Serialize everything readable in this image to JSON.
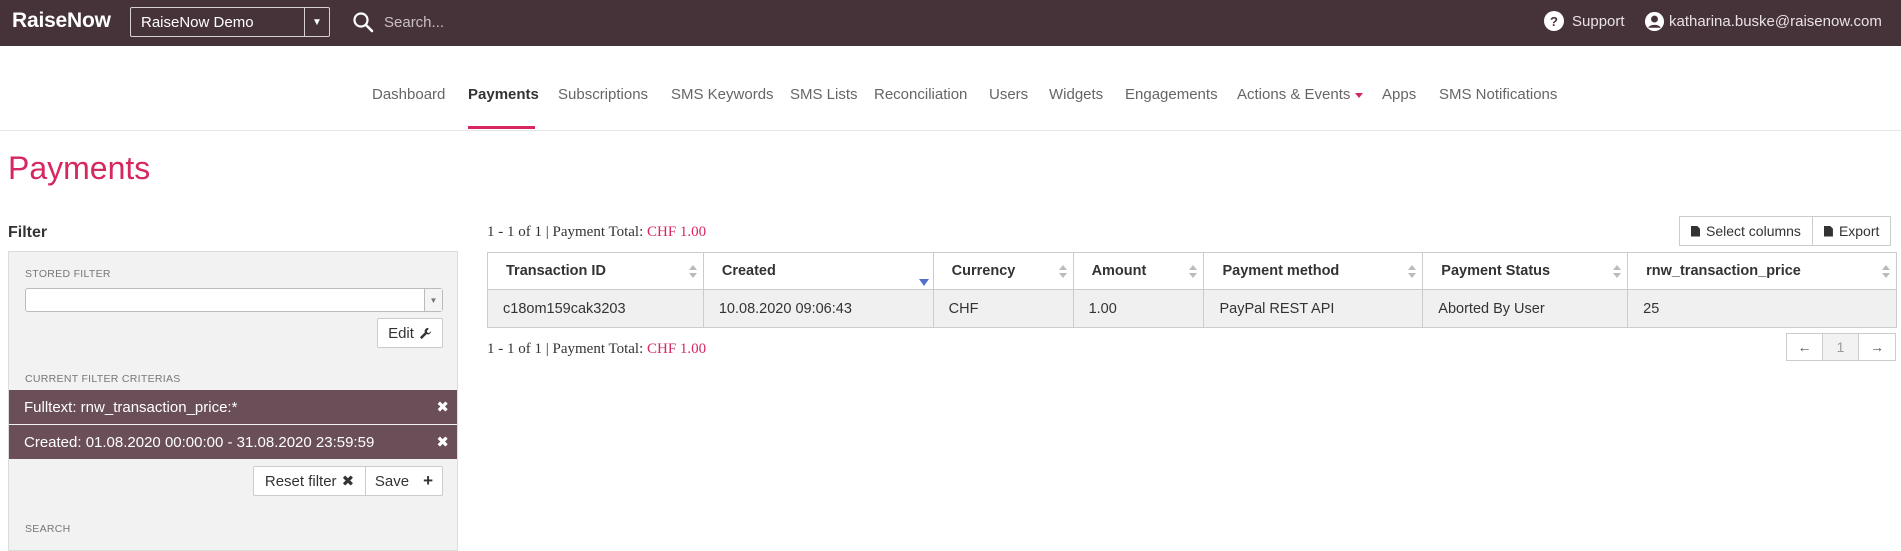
{
  "app": {
    "logo": "RaiseNow",
    "org_selector": "RaiseNow Demo",
    "search_placeholder": "Search...",
    "support_label": "Support",
    "user_email": "katharina.buske@raisenow.com"
  },
  "nav": {
    "items": [
      {
        "label": "Dashboard"
      },
      {
        "label": "Payments",
        "active": true
      },
      {
        "label": "Subscriptions"
      },
      {
        "label": "SMS Keywords"
      },
      {
        "label": "SMS Lists"
      },
      {
        "label": "Reconciliation"
      },
      {
        "label": "Users"
      },
      {
        "label": "Widgets"
      },
      {
        "label": "Engagements"
      },
      {
        "label": "Actions & Events",
        "has_dropdown": true
      },
      {
        "label": "Apps"
      },
      {
        "label": "SMS Notifications"
      }
    ],
    "accent_color": "#d6275f"
  },
  "page": {
    "title": "Payments"
  },
  "filter": {
    "heading": "Filter",
    "stored_filter_label": "STORED FILTER",
    "stored_filter_value": "",
    "edit_label": "Edit",
    "current_criteria_label": "CURRENT FILTER CRITERIAS",
    "criteria": [
      {
        "text": "Fulltext: rnw_transaction_price:*"
      },
      {
        "text": "Created: 01.08.2020 00:00:00 - 31.08.2020 23:59:59"
      }
    ],
    "reset_label": "Reset filter",
    "save_label": "Save",
    "search_label": "SEARCH"
  },
  "results": {
    "summary_prefix": "1 - 1 of 1 | Payment Total:",
    "summary_amount": "CHF 1.00",
    "select_columns_label": "Select columns",
    "export_label": "Export",
    "columns": [
      {
        "label": "Transaction ID"
      },
      {
        "label": "Created",
        "sorted": "desc"
      },
      {
        "label": "Currency"
      },
      {
        "label": "Amount"
      },
      {
        "label": "Payment method"
      },
      {
        "label": "Payment Status"
      },
      {
        "label": "rnw_transaction_price"
      }
    ],
    "rows": [
      [
        "c18om159cak3203",
        "10.08.2020 09:06:43",
        "CHF",
        "1.00",
        "PayPal REST API",
        "Aborted By User",
        "25"
      ]
    ],
    "pagination": {
      "prev": "←",
      "current": "1",
      "next": "→"
    }
  }
}
